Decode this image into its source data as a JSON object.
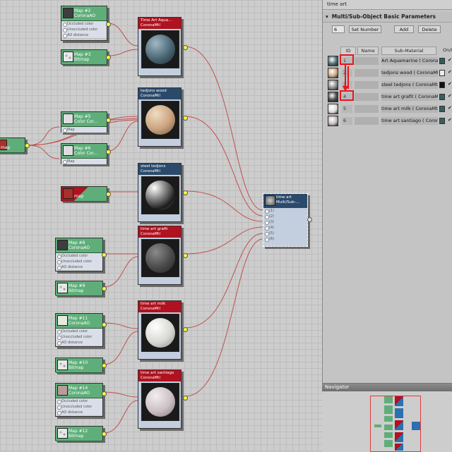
{
  "maps": {
    "map2": {
      "title": "Map #2",
      "type": "CoronaAO",
      "slots": [
        "Occluded color",
        "Unoccluded color",
        "AO distance"
      ]
    },
    "map3": {
      "title": "Map #3",
      "type": "Bitmap"
    },
    "map5": {
      "title": "Map #5",
      "type": "Color Cor...",
      "slots": [
        "Map"
      ]
    },
    "map6": {
      "title": "Map #6",
      "type": "Color Cor...",
      "slots": [
        "Map"
      ]
    },
    "map_left": {
      "type": "map"
    },
    "map_red": {
      "type": "map"
    },
    "map8": {
      "title": "Map #8",
      "type": "CoronaAO",
      "slots": [
        "Occluded color",
        "Unoccluded color",
        "AO distance"
      ]
    },
    "map9": {
      "title": "Map #9",
      "type": "Bitmap"
    },
    "map11": {
      "title": "Map #11",
      "type": "CoronaAO",
      "slots": [
        "Occluded color",
        "Unoccluded color",
        "AO distance"
      ]
    },
    "map10": {
      "title": "Map #10",
      "type": "Bitmap"
    },
    "map14": {
      "title": "Map #14",
      "type": "CoronaAO",
      "slots": [
        "Occluded color",
        "Unoccluded color",
        "AO distance"
      ]
    },
    "map12": {
      "title": "Map #12",
      "type": "Bitmap"
    }
  },
  "materials": {
    "aquamarine": {
      "title": "Time Art Aqua...",
      "type": "CoronaMtl"
    },
    "wood": {
      "title": "tedjons wood",
      "type": "CoronaMtl"
    },
    "steel": {
      "title": "steel tedjons",
      "type": "CoronaMtl"
    },
    "grafit": {
      "title": "time art grafit",
      "type": "CoronaMtl"
    },
    "milk": {
      "title": "time art milk",
      "type": "CoronaMtl"
    },
    "santiago": {
      "title": "time art santiago",
      "type": "CoronaMtl"
    }
  },
  "multi": {
    "title": "time art",
    "type": "Multi/Sub-...",
    "slots": [
      "(1)",
      "(2)",
      "(3)",
      "(4)",
      "(5)",
      "(6)"
    ]
  },
  "panel": {
    "title": "time art",
    "rollout": "Multi/Sub-Object Basic Parameters",
    "count": "6",
    "set_number": "Set Number",
    "add": "Add",
    "delete": "Delete",
    "col_id": "ID",
    "col_name": "Name",
    "col_sub": "Sub-Material",
    "col_onoff": "On/Off",
    "rows": [
      {
        "id": "1",
        "sub": "Art Aquamarine  ( CoronaMtl )",
        "swatch": "#4f6a74",
        "color": "#355a5a"
      },
      {
        "id": "2",
        "sub": "tedjons wood  ( CoronaMtl )",
        "swatch": "#cda882",
        "color": "#f0ede6"
      },
      {
        "id": "3",
        "sub": "steel tedjons  ( CoronaMtl )",
        "swatch": "#8a8a8a",
        "color": "#111111"
      },
      {
        "id": "4",
        "sub": "time art grafit  ( CoronaMtl )",
        "swatch": "#4a4a4a",
        "color": "#356060"
      },
      {
        "id": "5",
        "sub": "time art milk  ( CoronaMtl )",
        "swatch": "#dcdcd8",
        "color": "#356060"
      },
      {
        "id": "6",
        "sub": "time art santiago  ( CoronaMtl )",
        "swatch": "#c6bac0",
        "color": "#356060"
      }
    ],
    "checkmark": "✔"
  },
  "navigator": {
    "title": "Navigator"
  }
}
